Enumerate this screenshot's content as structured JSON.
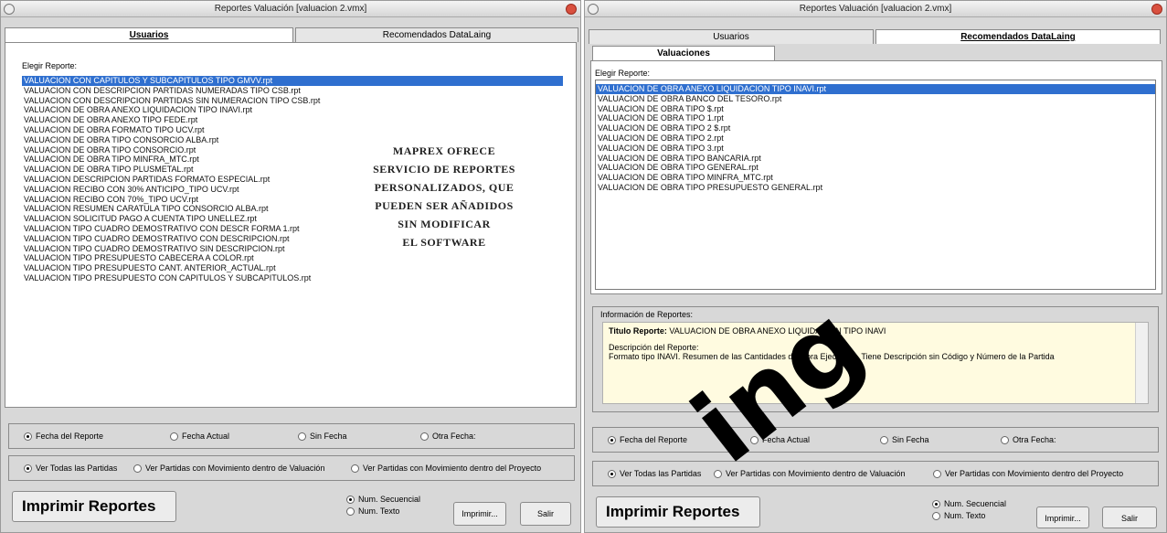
{
  "left_window": {
    "title": "Reportes Valuación [valuacion 2.vmx]",
    "tabs": [
      {
        "label": "Usuarios"
      },
      {
        "label": "Recomendados DataLaing"
      }
    ],
    "list_label": "Elegir Reporte:",
    "list_items": [
      "VALUACION CON CAPITULOS Y SUBCAPITULOS TIPO GMVV.rpt",
      "VALUACION CON DESCRIPCION PARTIDAS NUMERADAS TIPO CSB.rpt",
      "VALUACION CON DESCRIPCION PARTIDAS SIN NUMERACION TIPO CSB.rpt",
      "VALUACION DE OBRA ANEXO LIQUIDACION TIPO INAVI.rpt",
      "VALUACION DE OBRA ANEXO TIPO FEDE.rpt",
      "VALUACION DE OBRA FORMATO TIPO UCV.rpt",
      "VALUACION DE OBRA TIPO CONSORCIO ALBA.rpt",
      "VALUACION DE OBRA TIPO CONSORCIO.rpt",
      "VALUACION DE OBRA TIPO MINFRA_MTC.rpt",
      "VALUACION DE OBRA TIPO PLUSMETAL.rpt",
      "VALUACION DESCRIPCION PARTIDAS FORMATO ESPECIAL.rpt",
      "VALUACION RECIBO CON 30% ANTICIPO_TIPO UCV.rpt",
      "VALUACION RECIBO CON 70%_TIPO UCV.rpt",
      "VALUACION RESUMEN CARATULA TIPO CONSORCIO ALBA.rpt",
      "VALUACION SOLICITUD PAGO A CUENTA TIPO UNELLEZ.rpt",
      "VALUACION TIPO CUADRO DEMOSTRATIVO CON DESCR FORMA 1.rpt",
      "VALUACION TIPO CUADRO DEMOSTRATIVO CON DESCRIPCION.rpt",
      "VALUACION TIPO CUADRO DEMOSTRATIVO SIN DESCRIPCION.rpt",
      "VALUACION TIPO PRESUPUESTO CABECERA A COLOR.rpt",
      "VALUACION TIPO PRESUPUESTO CANT. ANTERIOR_ACTUAL.rpt",
      "VALUACION TIPO PRESUPUESTO CON CAPITULOS Y SUBCAPITULOS.rpt"
    ],
    "overlay_lines": [
      "MAPREX OFRECE",
      "SERVICIO DE REPORTES",
      "PERSONALIZADOS, QUE",
      "PUEDEN SER AÑADIDOS",
      "SIN MODIFICAR",
      "EL SOFTWARE"
    ],
    "date_options": [
      "Fecha del Reporte",
      "Fecha Actual",
      "Sin Fecha",
      "Otra Fecha:"
    ],
    "partida_options": [
      "Ver Todas las Partidas",
      "Ver Partidas con Movimiento dentro de Valuación",
      "Ver Partidas con Movimiento dentro del Proyecto"
    ],
    "big_button": "Imprimir Reportes",
    "num_options": [
      "Num. Secuencial",
      "Num. Texto"
    ],
    "imprimir": "Imprimir...",
    "salir": "Salir"
  },
  "right_window": {
    "title": "Reportes Valuación [valuacion 2.vmx]",
    "tabs": [
      {
        "label": "Usuarios"
      },
      {
        "label": "Recomendados DataLaing"
      }
    ],
    "subtab": "Valuaciones",
    "list_label": "Elegir Reporte:",
    "list_items": [
      "VALUACION DE OBRA ANEXO LIQUIDACION TIPO INAVI.rpt",
      "VALUACION DE OBRA BANCO DEL TESORO.rpt",
      "VALUACION DE OBRA TIPO $.rpt",
      "VALUACION DE OBRA TIPO 1.rpt",
      "VALUACION DE OBRA TIPO 2 $.rpt",
      "VALUACION DE OBRA TIPO 2.rpt",
      "VALUACION DE OBRA TIPO 3.rpt",
      "VALUACION DE OBRA TIPO BANCARIA.rpt",
      "VALUACION DE OBRA TIPO GENERAL.rpt",
      "VALUACION DE OBRA TIPO MINFRA_MTC.rpt",
      "VALUACION DE OBRA TIPO PRESUPUESTO GENERAL.rpt"
    ],
    "info": {
      "label": "Información de Reportes:",
      "titulo_label": "Titulo Reporte:",
      "titulo_value": "VALUACION DE OBRA ANEXO LIQUIDACION TIPO INAVI",
      "desc_label": "Descripción del Reporte:",
      "desc_value": "Formato tipo INAVI. Resumen de las Cantidades de Obra Ejecutada. Tiene Descripción sin Código y Número de la  Partida"
    },
    "date_options": [
      "Fecha del Reporte",
      "Fecha Actual",
      "Sin Fecha",
      "Otra Fecha:"
    ],
    "partida_options": [
      "Ver Todas las Partidas",
      "Ver Partidas con Movimiento dentro de Valuación",
      "Ver Partidas con Movimiento dentro del Proyecto"
    ],
    "big_button": "Imprimir Reportes",
    "num_options": [
      "Num. Secuencial",
      "Num. Texto"
    ],
    "imprimir": "Imprimir...",
    "salir": "Salir"
  },
  "watermark": "ing"
}
